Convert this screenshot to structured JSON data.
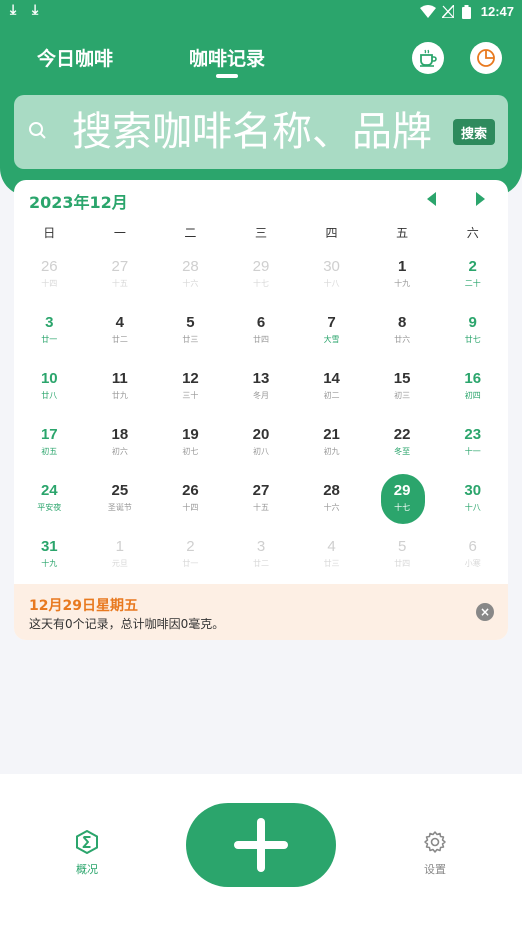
{
  "status_bar": {
    "time": "12:47"
  },
  "header": {
    "tabs": [
      {
        "label": "今日咖啡"
      },
      {
        "label": "咖啡记录",
        "active": true
      }
    ],
    "icons": {
      "left": "coffee-cup-icon",
      "right": "pie-chart-icon"
    }
  },
  "search": {
    "placeholder": "搜索咖啡名称、品牌",
    "button_label": "搜索"
  },
  "calendar": {
    "month_label": "2023年12月",
    "weekdays": [
      "日",
      "一",
      "二",
      "三",
      "四",
      "五",
      "六"
    ],
    "weeks": [
      [
        {
          "day": "26",
          "lunar": "十四",
          "other": true
        },
        {
          "day": "27",
          "lunar": "十五",
          "other": true
        },
        {
          "day": "28",
          "lunar": "十六",
          "other": true
        },
        {
          "day": "29",
          "lunar": "十七",
          "other": true
        },
        {
          "day": "30",
          "lunar": "十八",
          "other": true
        },
        {
          "day": "1",
          "lunar": "十九"
        },
        {
          "day": "2",
          "lunar": "二十"
        }
      ],
      [
        {
          "day": "3",
          "lunar": "廿一"
        },
        {
          "day": "4",
          "lunar": "廿二"
        },
        {
          "day": "5",
          "lunar": "廿三"
        },
        {
          "day": "6",
          "lunar": "廿四"
        },
        {
          "day": "7",
          "lunar": "大雪",
          "festival": true
        },
        {
          "day": "8",
          "lunar": "廿六"
        },
        {
          "day": "9",
          "lunar": "廿七"
        }
      ],
      [
        {
          "day": "10",
          "lunar": "廿八"
        },
        {
          "day": "11",
          "lunar": "廿九"
        },
        {
          "day": "12",
          "lunar": "三十"
        },
        {
          "day": "13",
          "lunar": "冬月"
        },
        {
          "day": "14",
          "lunar": "初二"
        },
        {
          "day": "15",
          "lunar": "初三"
        },
        {
          "day": "16",
          "lunar": "初四"
        }
      ],
      [
        {
          "day": "17",
          "lunar": "初五"
        },
        {
          "day": "18",
          "lunar": "初六"
        },
        {
          "day": "19",
          "lunar": "初七"
        },
        {
          "day": "20",
          "lunar": "初八"
        },
        {
          "day": "21",
          "lunar": "初九"
        },
        {
          "day": "22",
          "lunar": "冬至",
          "festival": true
        },
        {
          "day": "23",
          "lunar": "十一"
        }
      ],
      [
        {
          "day": "24",
          "lunar": "平安夜"
        },
        {
          "day": "25",
          "lunar": "圣诞节"
        },
        {
          "day": "26",
          "lunar": "十四"
        },
        {
          "day": "27",
          "lunar": "十五"
        },
        {
          "day": "28",
          "lunar": "十六"
        },
        {
          "day": "29",
          "lunar": "十七",
          "selected": true
        },
        {
          "day": "30",
          "lunar": "十八"
        }
      ],
      [
        {
          "day": "31",
          "lunar": "十九"
        },
        {
          "day": "1",
          "lunar": "元旦",
          "other": true
        },
        {
          "day": "2",
          "lunar": "廿一",
          "other": true
        },
        {
          "day": "3",
          "lunar": "廿二",
          "other": true
        },
        {
          "day": "4",
          "lunar": "廿三",
          "other": true
        },
        {
          "day": "5",
          "lunar": "廿四",
          "other": true
        },
        {
          "day": "6",
          "lunar": "小寒",
          "other": true
        }
      ]
    ]
  },
  "day_info": {
    "date_label": "12月29日星期五",
    "summary": "这天有0个记录，总计咖啡因0毫克。"
  },
  "bottom_nav": {
    "left": {
      "label": "概况",
      "icon": "sigma-icon",
      "active": true
    },
    "right": {
      "label": "设置",
      "icon": "gear-icon"
    }
  },
  "colors": {
    "accent": "#2ba56c",
    "highlight_orange": "#e8791f",
    "info_bg": "#fdefe4"
  }
}
